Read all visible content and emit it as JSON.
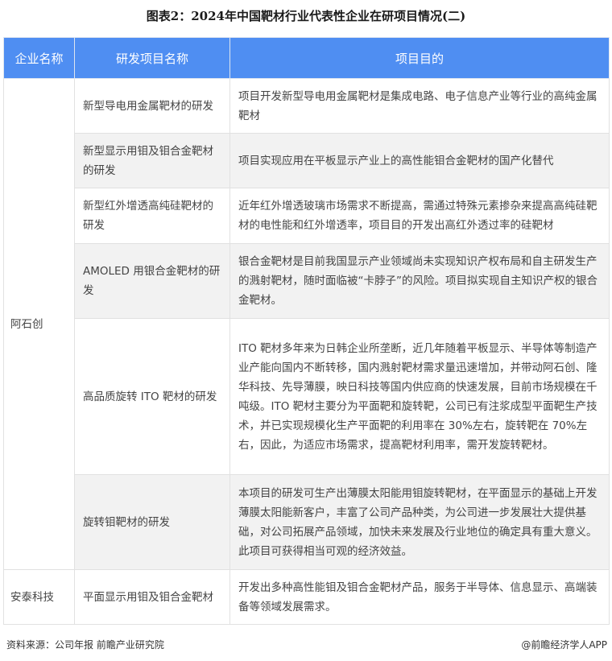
{
  "title": "图表2：2024年中国靶材行业代表性企业在研项目情况(二)",
  "table": {
    "headers": [
      "企业名称",
      "研发项目名称",
      "项目目的"
    ],
    "groups": [
      {
        "company": "阿石创"
      },
      {
        "company": "安泰科技"
      }
    ],
    "rows": [
      {
        "project": "新型导电用金属靶材的研发",
        "purpose": "项目开发新型导电用金属靶材是集成电路、电子信息产业等行业的高纯金属靶材"
      },
      {
        "project": "新型显示用钼及钼合金靶材的研发",
        "purpose": "项目实现应用在平板显示产业上的高性能钼合金靶材的国产化替代"
      },
      {
        "project": "新型红外增透高纯硅靶材的研发",
        "purpose": "近年红外增透玻璃市场需求不断提高，需通过特殊元素掺杂来提高高纯硅靶材的电性能和红外增透率，项目目的开发出高红外透过率的硅靶材"
      },
      {
        "project": "AMOLED 用银合金靶材的研发",
        "purpose": "银合金靶材是目前我国显示产业领域尚未实现知识产权布局和自主研发生产的溅射靶材，随时面临被“卡脖子”的风险。项目拟实现自主知识产权的银合金靶材。"
      },
      {
        "project": "高品质旋转 ITO 靶材的研发",
        "purpose": "ITO 靶材多年来为日韩企业所垄断，近几年随着平板显示、半导体等制造产业产能向国内不断转移，国内溅射靶材需求量迅速增加，并带动阿石创、隆华科技、先导薄膜，映日科技等国内供应商的快速发展，目前市场规模在千吨级。ITO 靶材主要分为平面靶和旋转靶，公司已有注浆成型平面靶生产技术，并已实现规模化生产平面靶的利用率在 30%左右，旋转靶在 70%左右，因此，为适应市场需求，提高靶材利用率，需开发旋转靶材。"
      },
      {
        "project": "旋转钼靶材的研发",
        "purpose": "本项目的研发可生产出薄膜太阳能用钼旋转靶材，在平面显示的基础上开发薄膜太阳能新客户，丰富了公司产品种类，为公司进一步发展壮大提供基础，对公司拓展产品领域，加快未来发展及行业地位的确定具有重大意义。此项目可获得相当可观的经济效益。"
      },
      {
        "project": "平面显示用钼及钼合金靶材",
        "purpose": "开发出多种高性能钼及钼合金靶材产品，服务于半导体、信息显示、高端装备等领域发展需求。"
      }
    ]
  },
  "footer": {
    "source": "资料来源：公司年报 前瞻产业研究院",
    "credit": "@前瞻经济学人APP"
  }
}
